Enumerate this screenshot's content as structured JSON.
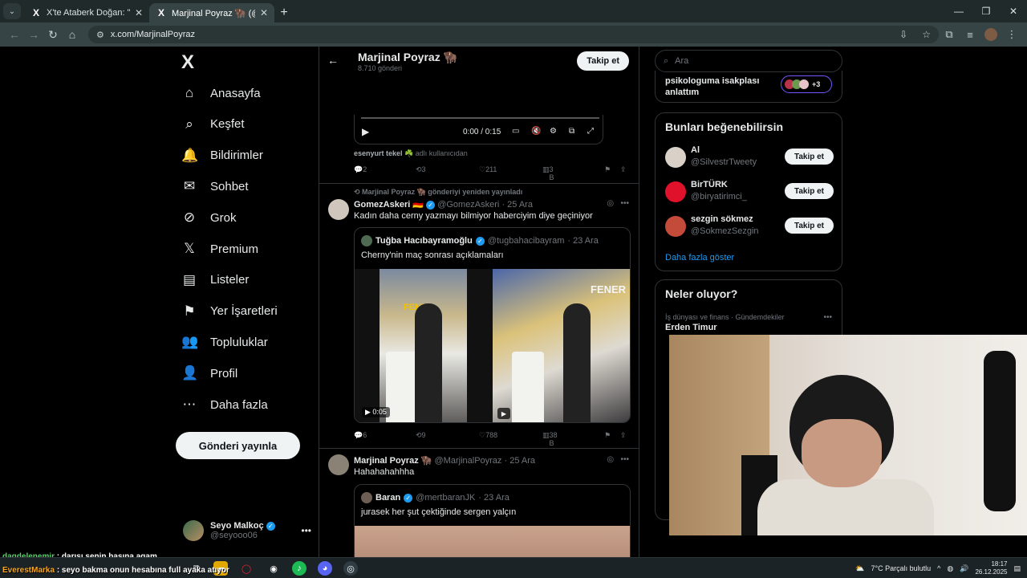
{
  "browser": {
    "tabs": [
      {
        "title": "X'te Ataberk Doğan: \"Selamlar",
        "active": false
      },
      {
        "title": "Marjinal Poyraz 🦬 (@Marjinal",
        "active": true
      }
    ],
    "url": "x.com/MarjinalPoyraz"
  },
  "nav": {
    "logo": "X",
    "items": [
      {
        "icon": "home-icon",
        "glyph": "⌂",
        "label": "Anasayfa"
      },
      {
        "icon": "search-icon",
        "glyph": "⌕",
        "label": "Keşfet"
      },
      {
        "icon": "bell-icon",
        "glyph": "🔔",
        "label": "Bildirimler"
      },
      {
        "icon": "mail-icon",
        "glyph": "✉",
        "label": "Sohbet"
      },
      {
        "icon": "grok-icon",
        "glyph": "⊘",
        "label": "Grok"
      },
      {
        "icon": "x-premium-icon",
        "glyph": "𝕏",
        "label": "Premium"
      },
      {
        "icon": "list-icon",
        "glyph": "▤",
        "label": "Listeler"
      },
      {
        "icon": "bookmark-icon",
        "glyph": "⚑",
        "label": "Yer İşaretleri"
      },
      {
        "icon": "communities-icon",
        "glyph": "👥",
        "label": "Topluluklar"
      },
      {
        "icon": "profile-icon",
        "glyph": "👤",
        "label": "Profil"
      },
      {
        "icon": "more-icon",
        "glyph": "⋯",
        "label": "Daha fazla"
      }
    ],
    "post_button": "Gönderi yayınla",
    "me": {
      "name": "Seyo Malkoç",
      "handle": "@seyooo06"
    }
  },
  "profile_header": {
    "name": "Marjinal Poyraz 🦬",
    "count": "8.710 gönderi",
    "follow": "Takip et"
  },
  "post1": {
    "video_time": "0:00 / 0:15",
    "attribution_name": "esenyurt tekel ☘️",
    "attribution_suffix": "adlı kullanıcıdan",
    "replies": "2",
    "reposts": "3",
    "likes": "211",
    "views": "3 B"
  },
  "post2": {
    "repost_note": "Marjinal Poyraz 🦬 gönderiyi yeniden yayınladı",
    "author": "GomezAskeri 🇩🇪",
    "handle": "@GomezAskeri",
    "date": "· 25 Ara",
    "text": "Kadın daha cerny yazmayı bilmiyor haberciyim diye geçiniyor",
    "quote": {
      "author": "Tuğba Hacıbayramoğlu",
      "handle": "@tugbahacibayram",
      "date": "· 23 Ara",
      "text": "Cherny'nin maç sonrası açıklamaları",
      "duration": "0:05",
      "sign_left": "FENER",
      "sign_right": "FENER"
    },
    "replies": "6",
    "reposts": "9",
    "likes": "788",
    "views": "38 B"
  },
  "post3": {
    "author": "Marjinal Poyraz 🦬",
    "handle": "@MarjinalPoyraz",
    "date": "· 25 Ara",
    "text": "Hahahahahhha",
    "quote": {
      "author": "Baran",
      "handle": "@mertbaranJK",
      "date": "· 23 Ara",
      "text": "jurasek her şut çektiğinde sergen yalçın"
    }
  },
  "sidebar": {
    "search_placeholder": "Ara",
    "trend_top": {
      "text": "psikologuma isakplası anlattım",
      "more": "+3"
    },
    "who_to_follow": {
      "title": "Bunları beğenebilirsin",
      "users": [
        {
          "name": "Al",
          "handle": "@SilvestrTweety",
          "button": "Takip et"
        },
        {
          "name": "BirTÜRK",
          "handle": "@biryatirimci_",
          "button": "Takip et"
        },
        {
          "name": "sezgin sökmez",
          "handle": "@SokmezSezgin",
          "button": "Takip et"
        }
      ],
      "more": "Daha fazla göster"
    },
    "trends": {
      "title": "Neler oluyor?",
      "category": "İş dünyası ve finans · Gündemdekiler",
      "name": "Erden Timur"
    }
  },
  "chat": [
    {
      "user": "dagdelenemir",
      "text": " : darısı senin başına agam"
    },
    {
      "user": "EverestMarka",
      "text": " : seyo bakma onun hesabına full ayaka atıyor"
    }
  ],
  "taskbar": {
    "weather": "7°C  Parçalı bulutlu",
    "time": "18:17",
    "date": "26.12.2025"
  }
}
